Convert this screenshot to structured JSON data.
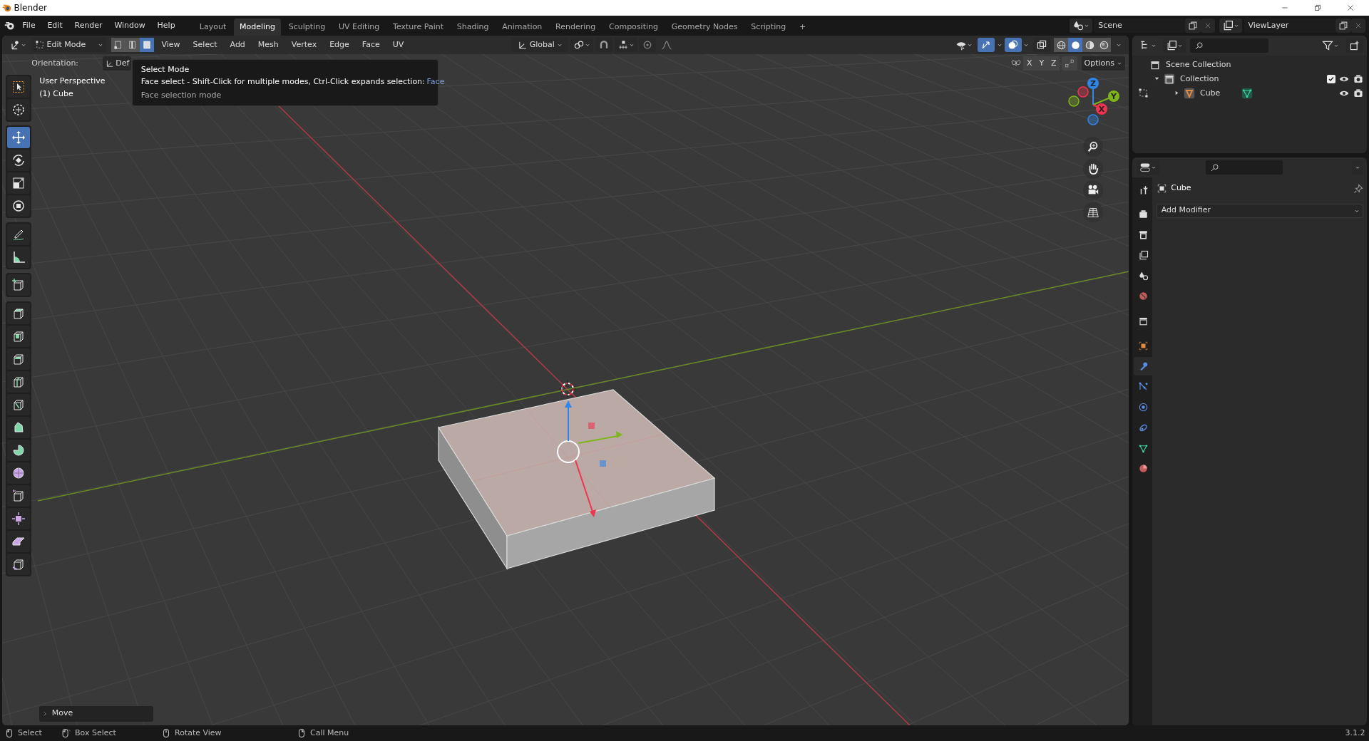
{
  "window": {
    "title": "Blender"
  },
  "menu_bar": {
    "menus": [
      "File",
      "Edit",
      "Render",
      "Window",
      "Help"
    ],
    "workspaces": [
      {
        "label": "Layout",
        "selected": false
      },
      {
        "label": "Modeling",
        "selected": true
      },
      {
        "label": "Sculpting",
        "selected": false
      },
      {
        "label": "UV Editing",
        "selected": false
      },
      {
        "label": "Texture Paint",
        "selected": false
      },
      {
        "label": "Shading",
        "selected": false
      },
      {
        "label": "Animation",
        "selected": false
      },
      {
        "label": "Rendering",
        "selected": false
      },
      {
        "label": "Compositing",
        "selected": false
      },
      {
        "label": "Geometry Nodes",
        "selected": false
      },
      {
        "label": "Scripting",
        "selected": false
      }
    ],
    "add_workspace": "+",
    "scene": "Scene",
    "view_layer": "ViewLayer"
  },
  "viewport_header": {
    "mode": "Edit Mode",
    "select_modes": [
      {
        "kind": "vertex",
        "selected": false
      },
      {
        "kind": "edge",
        "selected": false
      },
      {
        "kind": "face",
        "selected": true
      }
    ],
    "menus": [
      "View",
      "Select",
      "Add",
      "Mesh",
      "Vertex",
      "Edge",
      "Face",
      "UV"
    ],
    "orientation": "Global",
    "shading_modes": [
      {
        "kind": "wireframe",
        "selected": false
      },
      {
        "kind": "solid",
        "selected": true
      },
      {
        "kind": "material",
        "selected": false
      },
      {
        "kind": "rendered",
        "selected": false
      }
    ]
  },
  "tool_settings": {
    "orientation_label": "Orientation:",
    "orientation_value": "Def",
    "mirror_axes": [
      "X",
      "Y",
      "Z"
    ],
    "options": "Options"
  },
  "tooltip": {
    "title": "Select Mode",
    "description": "Face select - Shift-Click for multiple modes, Ctrl-Click expands selection:",
    "value": "Face",
    "python": "Face selection mode"
  },
  "toolbar": {
    "groups": [
      [
        {
          "kind": "select_box",
          "selected": false
        },
        {
          "kind": "cursor",
          "selected": false
        }
      ],
      [
        {
          "kind": "move",
          "selected": true
        },
        {
          "kind": "rotate",
          "selected": false
        },
        {
          "kind": "scale",
          "selected": false
        },
        {
          "kind": "transform",
          "selected": false
        }
      ],
      [
        {
          "kind": "annotate",
          "selected": false
        },
        {
          "kind": "measure",
          "selected": false
        }
      ],
      [
        {
          "kind": "add_cube",
          "selected": false
        }
      ],
      [
        {
          "kind": "extrude",
          "selected": false
        },
        {
          "kind": "inset",
          "selected": false
        },
        {
          "kind": "bevel",
          "selected": false
        },
        {
          "kind": "loop_cut",
          "selected": false
        },
        {
          "kind": "knife",
          "selected": false
        },
        {
          "kind": "poly_build",
          "selected": false
        },
        {
          "kind": "spin",
          "selected": false
        },
        {
          "kind": "smooth",
          "selected": false
        },
        {
          "kind": "edge_slide",
          "selected": false
        },
        {
          "kind": "shrink",
          "selected": false
        },
        {
          "kind": "shear",
          "selected": false
        },
        {
          "kind": "rip",
          "selected": false
        }
      ]
    ]
  },
  "viewport": {
    "view_name": "User Perspective",
    "object_label": "(1) Cube",
    "gizmo_axes": [
      {
        "label": "Z",
        "color": "#2e87e8"
      },
      {
        "label": "Y",
        "color": "#7fb51a"
      },
      {
        "label": "X",
        "color": "#f0334f"
      }
    ],
    "last_operator": "Move"
  },
  "outliner": {
    "items": [
      {
        "label": "Scene Collection",
        "children": [
          {
            "label": "Collection",
            "expanded": true,
            "checked": true,
            "children": [
              {
                "label": "Cube",
                "expanded": false
              }
            ]
          }
        ]
      }
    ]
  },
  "properties": {
    "tabs": [
      {
        "kind": "tool",
        "selected": false
      },
      {
        "kind": "render",
        "selected": false
      },
      {
        "kind": "output",
        "selected": false
      },
      {
        "kind": "view_layer",
        "selected": false
      },
      {
        "kind": "scene",
        "selected": false
      },
      {
        "kind": "world",
        "selected": false
      },
      {
        "kind": "collection",
        "selected": false
      },
      {
        "kind": "object",
        "selected": false
      },
      {
        "kind": "modifiers",
        "selected": true
      },
      {
        "kind": "particles",
        "selected": false
      },
      {
        "kind": "physics",
        "selected": false
      },
      {
        "kind": "constraints",
        "selected": false
      },
      {
        "kind": "data",
        "selected": false
      },
      {
        "kind": "material",
        "selected": false
      }
    ],
    "object_name": "Cube",
    "add_modifier": "Add Modifier"
  },
  "status_bar": {
    "hints": [
      {
        "label": "Select",
        "kind": "left"
      },
      {
        "label": "Box Select",
        "kind": "drag"
      },
      {
        "label": "Rotate View",
        "kind": "middle"
      },
      {
        "label": "Call Menu",
        "kind": "right"
      }
    ],
    "version": "3.1.2"
  }
}
